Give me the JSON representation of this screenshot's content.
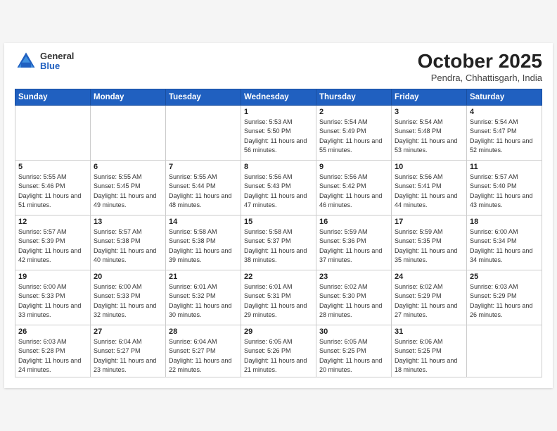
{
  "header": {
    "logo_general": "General",
    "logo_blue": "Blue",
    "month_title": "October 2025",
    "location": "Pendra, Chhattisgarh, India"
  },
  "weekdays": [
    "Sunday",
    "Monday",
    "Tuesday",
    "Wednesday",
    "Thursday",
    "Friday",
    "Saturday"
  ],
  "weeks": [
    [
      {
        "day": "",
        "sunrise": "",
        "sunset": "",
        "daylight": "",
        "empty": true
      },
      {
        "day": "",
        "sunrise": "",
        "sunset": "",
        "daylight": "",
        "empty": true
      },
      {
        "day": "",
        "sunrise": "",
        "sunset": "",
        "daylight": "",
        "empty": true
      },
      {
        "day": "1",
        "sunrise": "Sunrise: 5:53 AM",
        "sunset": "Sunset: 5:50 PM",
        "daylight": "Daylight: 11 hours and 56 minutes."
      },
      {
        "day": "2",
        "sunrise": "Sunrise: 5:54 AM",
        "sunset": "Sunset: 5:49 PM",
        "daylight": "Daylight: 11 hours and 55 minutes."
      },
      {
        "day": "3",
        "sunrise": "Sunrise: 5:54 AM",
        "sunset": "Sunset: 5:48 PM",
        "daylight": "Daylight: 11 hours and 53 minutes."
      },
      {
        "day": "4",
        "sunrise": "Sunrise: 5:54 AM",
        "sunset": "Sunset: 5:47 PM",
        "daylight": "Daylight: 11 hours and 52 minutes."
      }
    ],
    [
      {
        "day": "5",
        "sunrise": "Sunrise: 5:55 AM",
        "sunset": "Sunset: 5:46 PM",
        "daylight": "Daylight: 11 hours and 51 minutes."
      },
      {
        "day": "6",
        "sunrise": "Sunrise: 5:55 AM",
        "sunset": "Sunset: 5:45 PM",
        "daylight": "Daylight: 11 hours and 49 minutes."
      },
      {
        "day": "7",
        "sunrise": "Sunrise: 5:55 AM",
        "sunset": "Sunset: 5:44 PM",
        "daylight": "Daylight: 11 hours and 48 minutes."
      },
      {
        "day": "8",
        "sunrise": "Sunrise: 5:56 AM",
        "sunset": "Sunset: 5:43 PM",
        "daylight": "Daylight: 11 hours and 47 minutes."
      },
      {
        "day": "9",
        "sunrise": "Sunrise: 5:56 AM",
        "sunset": "Sunset: 5:42 PM",
        "daylight": "Daylight: 11 hours and 46 minutes."
      },
      {
        "day": "10",
        "sunrise": "Sunrise: 5:56 AM",
        "sunset": "Sunset: 5:41 PM",
        "daylight": "Daylight: 11 hours and 44 minutes."
      },
      {
        "day": "11",
        "sunrise": "Sunrise: 5:57 AM",
        "sunset": "Sunset: 5:40 PM",
        "daylight": "Daylight: 11 hours and 43 minutes."
      }
    ],
    [
      {
        "day": "12",
        "sunrise": "Sunrise: 5:57 AM",
        "sunset": "Sunset: 5:39 PM",
        "daylight": "Daylight: 11 hours and 42 minutes."
      },
      {
        "day": "13",
        "sunrise": "Sunrise: 5:57 AM",
        "sunset": "Sunset: 5:38 PM",
        "daylight": "Daylight: 11 hours and 40 minutes."
      },
      {
        "day": "14",
        "sunrise": "Sunrise: 5:58 AM",
        "sunset": "Sunset: 5:38 PM",
        "daylight": "Daylight: 11 hours and 39 minutes."
      },
      {
        "day": "15",
        "sunrise": "Sunrise: 5:58 AM",
        "sunset": "Sunset: 5:37 PM",
        "daylight": "Daylight: 11 hours and 38 minutes."
      },
      {
        "day": "16",
        "sunrise": "Sunrise: 5:59 AM",
        "sunset": "Sunset: 5:36 PM",
        "daylight": "Daylight: 11 hours and 37 minutes."
      },
      {
        "day": "17",
        "sunrise": "Sunrise: 5:59 AM",
        "sunset": "Sunset: 5:35 PM",
        "daylight": "Daylight: 11 hours and 35 minutes."
      },
      {
        "day": "18",
        "sunrise": "Sunrise: 6:00 AM",
        "sunset": "Sunset: 5:34 PM",
        "daylight": "Daylight: 11 hours and 34 minutes."
      }
    ],
    [
      {
        "day": "19",
        "sunrise": "Sunrise: 6:00 AM",
        "sunset": "Sunset: 5:33 PM",
        "daylight": "Daylight: 11 hours and 33 minutes."
      },
      {
        "day": "20",
        "sunrise": "Sunrise: 6:00 AM",
        "sunset": "Sunset: 5:33 PM",
        "daylight": "Daylight: 11 hours and 32 minutes."
      },
      {
        "day": "21",
        "sunrise": "Sunrise: 6:01 AM",
        "sunset": "Sunset: 5:32 PM",
        "daylight": "Daylight: 11 hours and 30 minutes."
      },
      {
        "day": "22",
        "sunrise": "Sunrise: 6:01 AM",
        "sunset": "Sunset: 5:31 PM",
        "daylight": "Daylight: 11 hours and 29 minutes."
      },
      {
        "day": "23",
        "sunrise": "Sunrise: 6:02 AM",
        "sunset": "Sunset: 5:30 PM",
        "daylight": "Daylight: 11 hours and 28 minutes."
      },
      {
        "day": "24",
        "sunrise": "Sunrise: 6:02 AM",
        "sunset": "Sunset: 5:29 PM",
        "daylight": "Daylight: 11 hours and 27 minutes."
      },
      {
        "day": "25",
        "sunrise": "Sunrise: 6:03 AM",
        "sunset": "Sunset: 5:29 PM",
        "daylight": "Daylight: 11 hours and 26 minutes."
      }
    ],
    [
      {
        "day": "26",
        "sunrise": "Sunrise: 6:03 AM",
        "sunset": "Sunset: 5:28 PM",
        "daylight": "Daylight: 11 hours and 24 minutes."
      },
      {
        "day": "27",
        "sunrise": "Sunrise: 6:04 AM",
        "sunset": "Sunset: 5:27 PM",
        "daylight": "Daylight: 11 hours and 23 minutes."
      },
      {
        "day": "28",
        "sunrise": "Sunrise: 6:04 AM",
        "sunset": "Sunset: 5:27 PM",
        "daylight": "Daylight: 11 hours and 22 minutes."
      },
      {
        "day": "29",
        "sunrise": "Sunrise: 6:05 AM",
        "sunset": "Sunset: 5:26 PM",
        "daylight": "Daylight: 11 hours and 21 minutes."
      },
      {
        "day": "30",
        "sunrise": "Sunrise: 6:05 AM",
        "sunset": "Sunset: 5:25 PM",
        "daylight": "Daylight: 11 hours and 20 minutes."
      },
      {
        "day": "31",
        "sunrise": "Sunrise: 6:06 AM",
        "sunset": "Sunset: 5:25 PM",
        "daylight": "Daylight: 11 hours and 18 minutes."
      },
      {
        "day": "",
        "sunrise": "",
        "sunset": "",
        "daylight": "",
        "empty": true
      }
    ]
  ]
}
